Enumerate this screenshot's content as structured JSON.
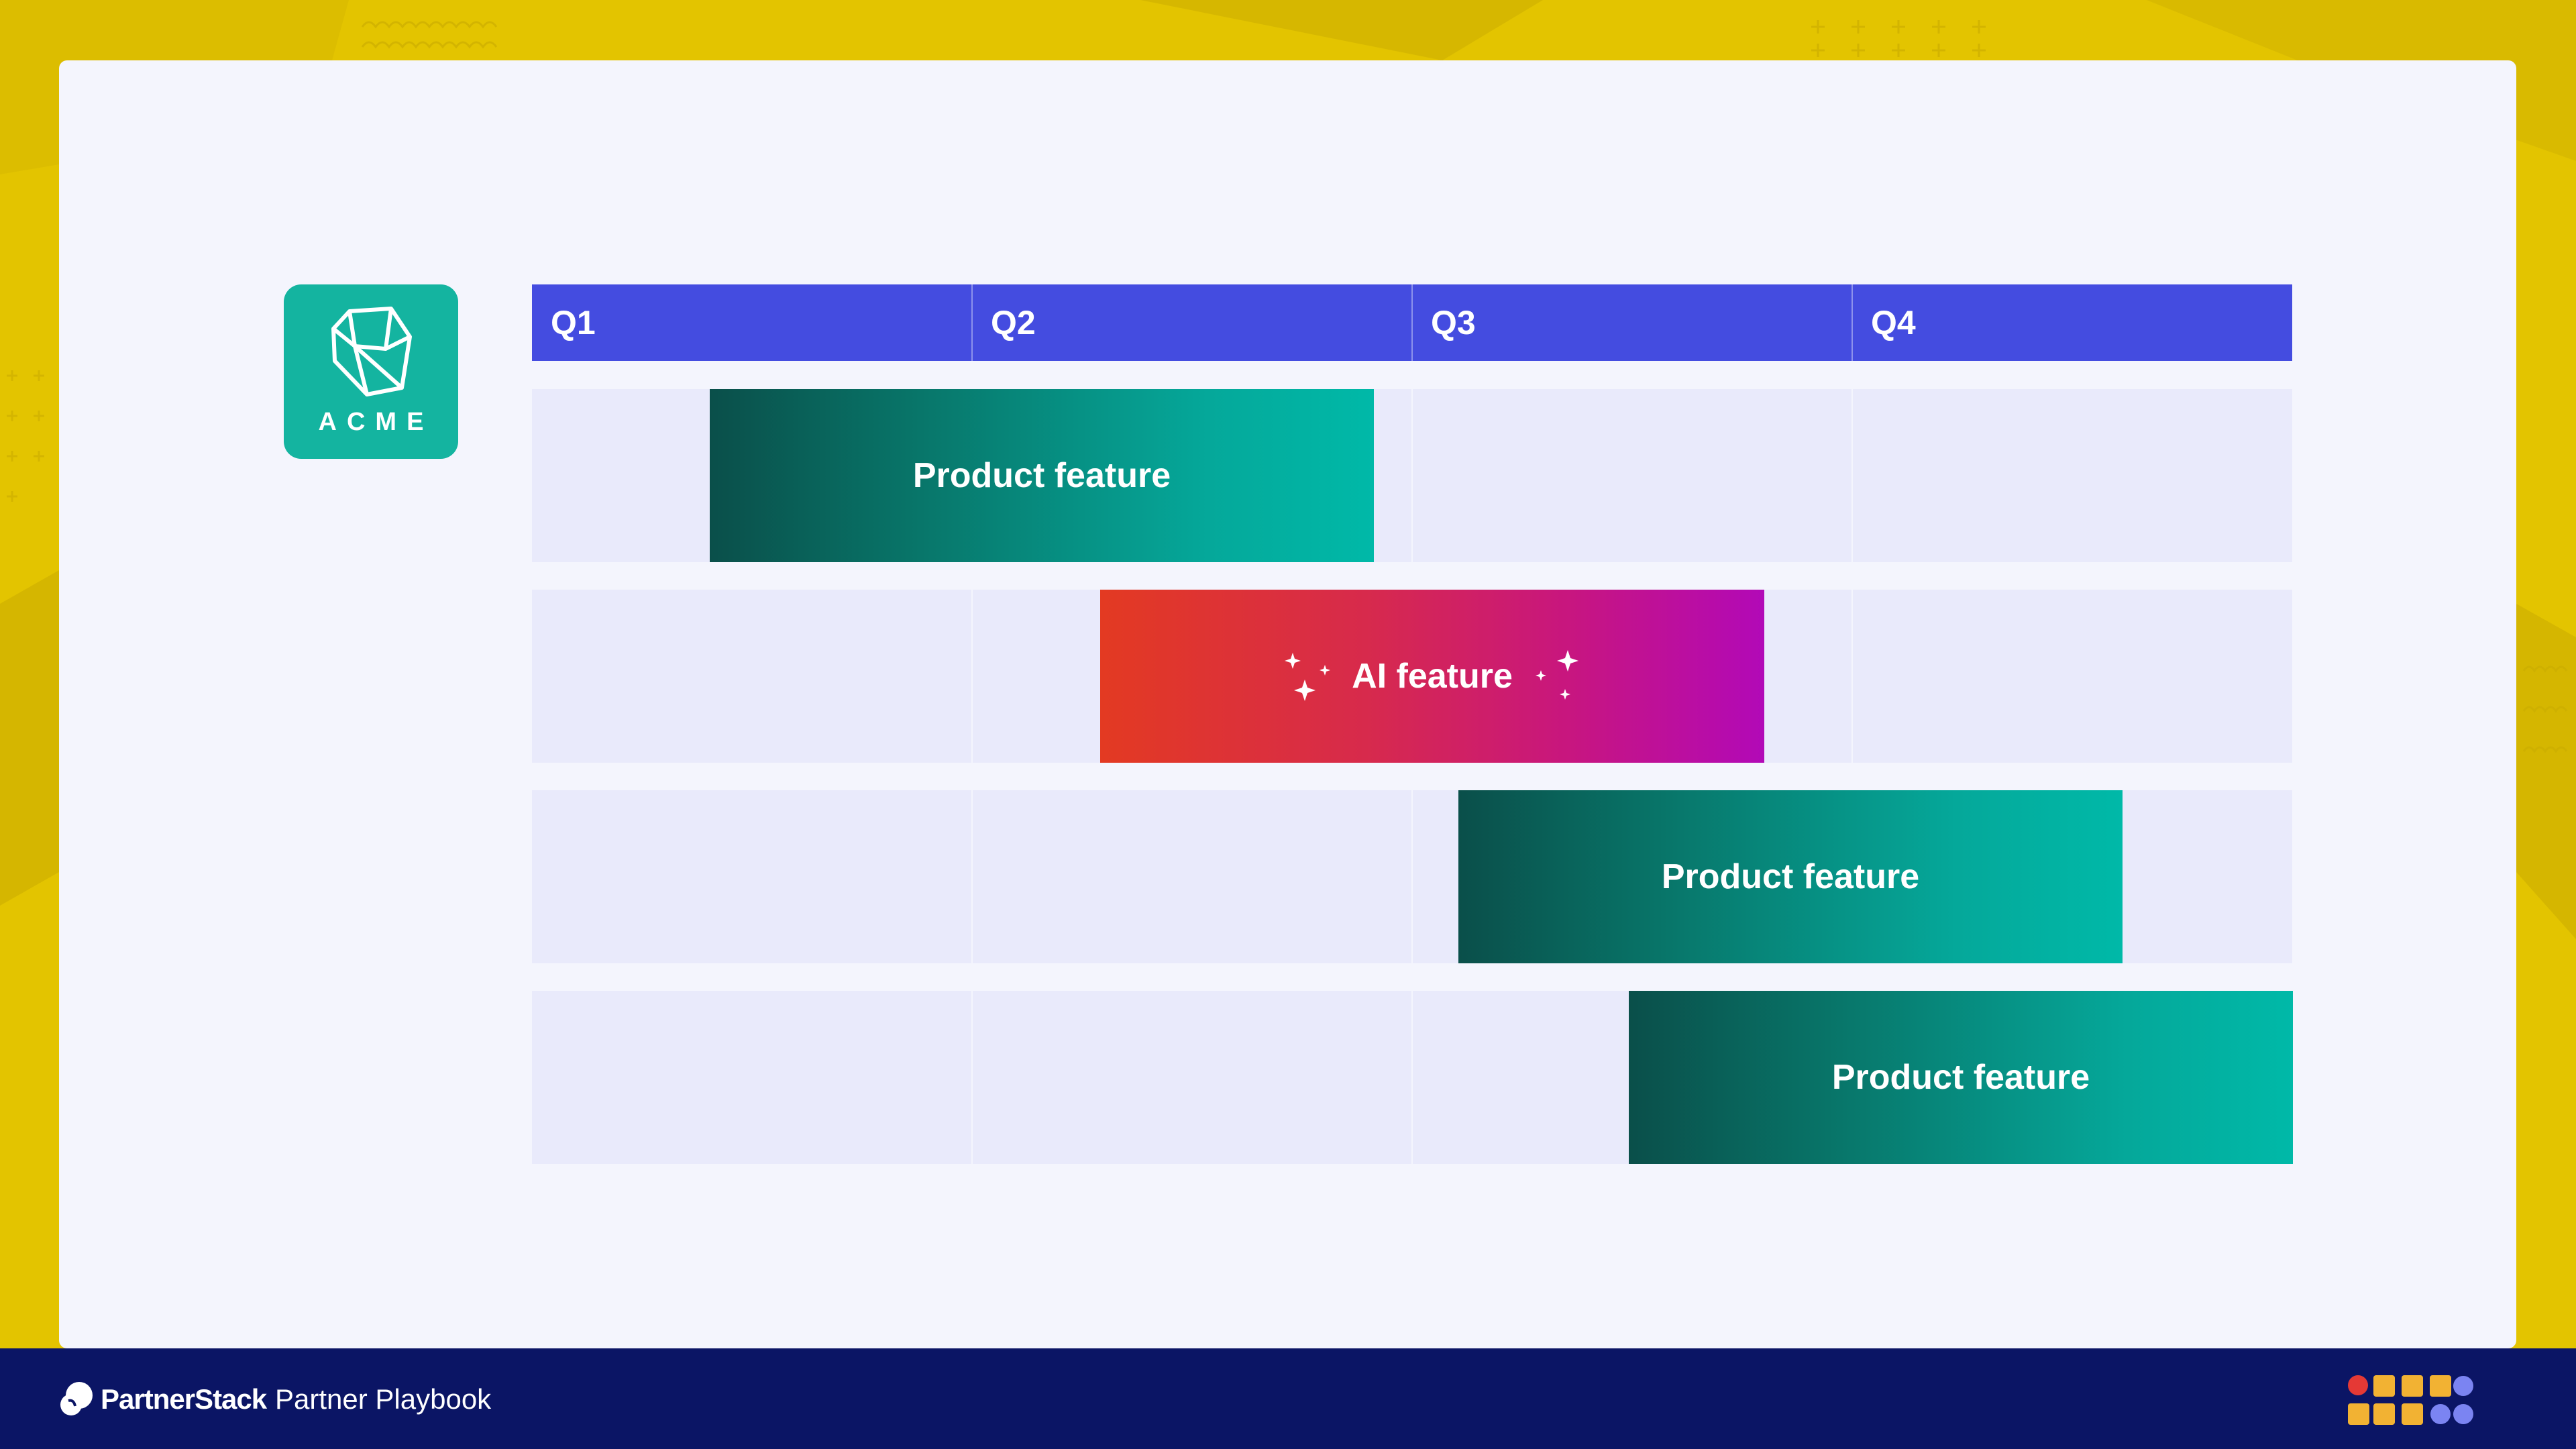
{
  "brand": {
    "acme_logo_text": "ACME",
    "partnerstack_name": "PartnerStack",
    "playbook_label": "Partner Playbook"
  },
  "roadmap": {
    "quarters": [
      "Q1",
      "Q2",
      "Q3",
      "Q4"
    ],
    "features": [
      {
        "label": "Product feature",
        "kind": "product",
        "start_quarter": 1.4,
        "end_quarter": 2.9
      },
      {
        "label": "AI feature",
        "kind": "ai",
        "start_quarter": 2.29,
        "end_quarter": 3.79
      },
      {
        "label": "Product feature",
        "kind": "product",
        "start_quarter": 3.1,
        "end_quarter": 4.62
      },
      {
        "label": "Product feature",
        "kind": "product",
        "start_quarter": 3.49,
        "end_quarter": 5.0
      }
    ]
  },
  "colors": {
    "background_yellow": "#e3c400",
    "quarter_header": "#444ce0",
    "acme_teal": "#14b4a0",
    "product_gradient": [
      "#0a4f4a",
      "#00b9a8"
    ],
    "ai_gradient": [
      "#e33a22",
      "#b209b7"
    ],
    "footer_navy": "#0b1565"
  },
  "icons": {
    "acme": "wireframe-cube-icon",
    "ai": "sparkles-icon",
    "partnerstack": "partnerstack-logo-icon",
    "footer_mark": "dot-grid-icon"
  }
}
